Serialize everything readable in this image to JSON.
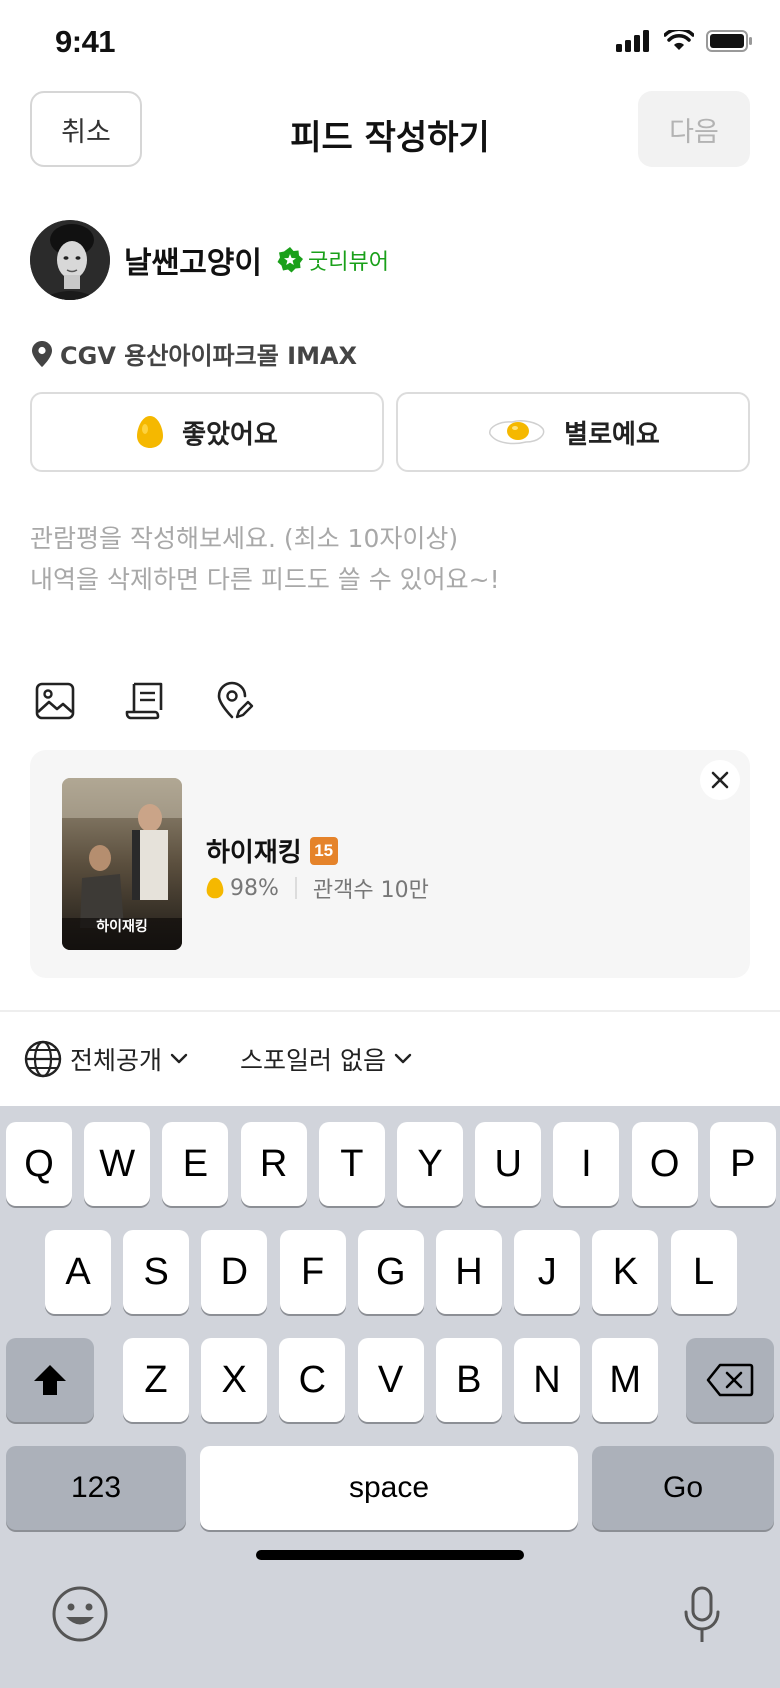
{
  "status_bar": {
    "time": "9:41"
  },
  "header": {
    "cancel_label": "취소",
    "title": "피드 작성하기",
    "next_label": "다음"
  },
  "profile": {
    "username": "날쌘고양이",
    "badge_label": "굿리뷰어"
  },
  "location": {
    "label": "CGV 용산아이파크몰 IMAX",
    "icon": "map-pin-icon"
  },
  "rating": {
    "good_label": "좋았어요",
    "bad_label": "별로예요"
  },
  "review": {
    "placeholder": "관람평을 작성해보세요. (최소 10자이상)\n내역을 삭제하면 다른 피드도 쓸 수 있어요~!"
  },
  "attachments": [
    {
      "icon": "image-icon"
    },
    {
      "icon": "receipt-icon"
    },
    {
      "icon": "location-edit-icon"
    }
  ],
  "movie": {
    "title": "하이재킹",
    "age_rating": "15",
    "egg_score": "98%",
    "audience": "관객수 10만",
    "poster_title": "하이재킹"
  },
  "options": {
    "visibility_label": "전체공개",
    "spoiler_label": "스포일러 없음"
  },
  "keyboard": {
    "row1": [
      "Q",
      "W",
      "E",
      "R",
      "T",
      "Y",
      "U",
      "I",
      "O",
      "P"
    ],
    "row2": [
      "A",
      "S",
      "D",
      "F",
      "G",
      "H",
      "J",
      "K",
      "L"
    ],
    "row3": [
      "Z",
      "X",
      "C",
      "V",
      "B",
      "N",
      "M"
    ],
    "numbers_label": "123",
    "space_label": "space",
    "go_label": "Go"
  },
  "colors": {
    "accent_green": "#1aa01a",
    "egg_yellow": "#f5b800",
    "age_orange": "#e5832a"
  }
}
